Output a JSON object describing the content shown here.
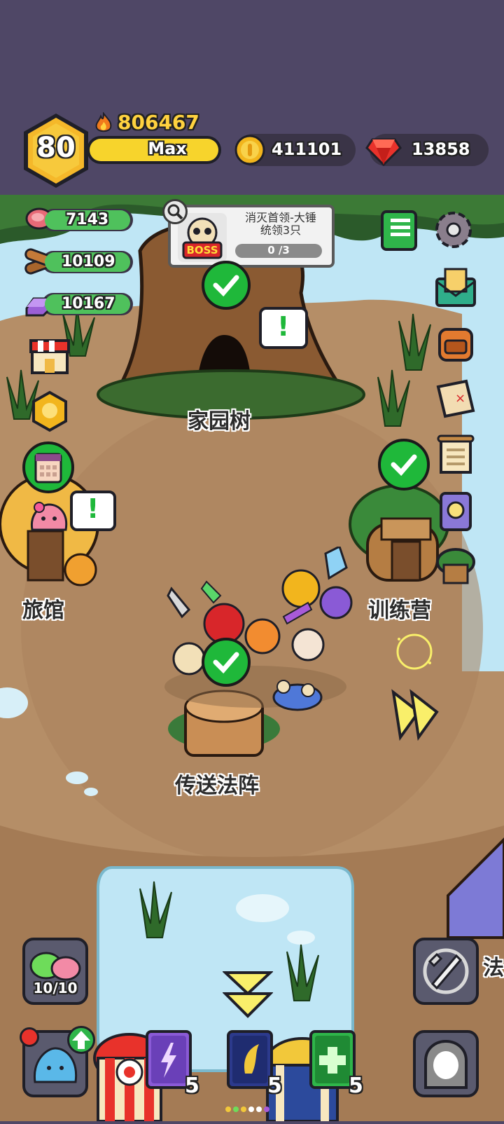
{
  "player": {
    "level": "80",
    "power": "806467",
    "exp_label": "Max"
  },
  "currency": {
    "gold": "411101",
    "gems": "13858"
  },
  "resources": {
    "meat": "7143",
    "wood": "10109",
    "crystal": "10167"
  },
  "quest": {
    "boss_tag": "BOSS",
    "text_line1": "消灭首领-大锤",
    "text_line2": "统领3只",
    "progress": "0 /3"
  },
  "buildings": {
    "home_tree": "家园树",
    "inn": "旅馆",
    "training_camp": "训练营",
    "teleport": "传送法阵",
    "partial_right": "法"
  },
  "bottom": {
    "slime_count": "10/10",
    "book1_count": "5",
    "book2_count": "5",
    "book3_count": "5"
  },
  "colors": {
    "top_bg": "#4f4766",
    "ground": "#b58e67",
    "water": "#bfe6f5",
    "accent_yellow": "#f5d43a",
    "check_green": "#1fb83a"
  }
}
